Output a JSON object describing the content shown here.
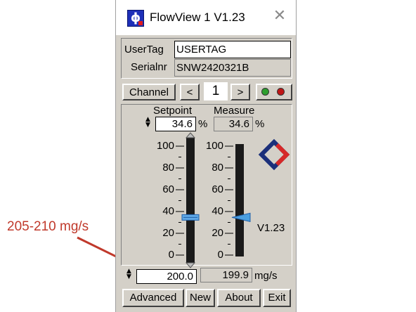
{
  "window": {
    "title": "FlowView 1 V1.23",
    "close_glyph": "✕",
    "app_icon_glyph": "ϕ"
  },
  "info": {
    "usertag_label": "UserTag",
    "usertag_value": "USERTAG",
    "serial_label": "Serialnr",
    "serial_value": "SNW2420321B"
  },
  "channel": {
    "label": "Channel",
    "prev": "<",
    "number": "1",
    "next": ">",
    "led_green": "#2e9e2e",
    "led_red": "#c01616"
  },
  "readout": {
    "setpoint_label": "Setpoint",
    "measure_label": "Measure",
    "setpoint_value": "34.6",
    "measure_value": "34.6",
    "unit_percent": "%",
    "setpoint_percent": 34.6,
    "measure_percent": 34.6
  },
  "scale": {
    "ticks": [
      "100",
      "80",
      "60",
      "40",
      "20",
      "0"
    ]
  },
  "version": "V1.23",
  "brand_colors": {
    "blue": "#1b2f7a",
    "red": "#d62828"
  },
  "flow": {
    "setpoint_value": "200.0",
    "measure_value": "199.9",
    "unit": "mg/s"
  },
  "buttons": {
    "advanced": "Advanced",
    "new": "New",
    "about": "About",
    "exit": "Exit"
  },
  "annotation": {
    "text": "205-210 mg/s",
    "color": "#c0392b"
  }
}
